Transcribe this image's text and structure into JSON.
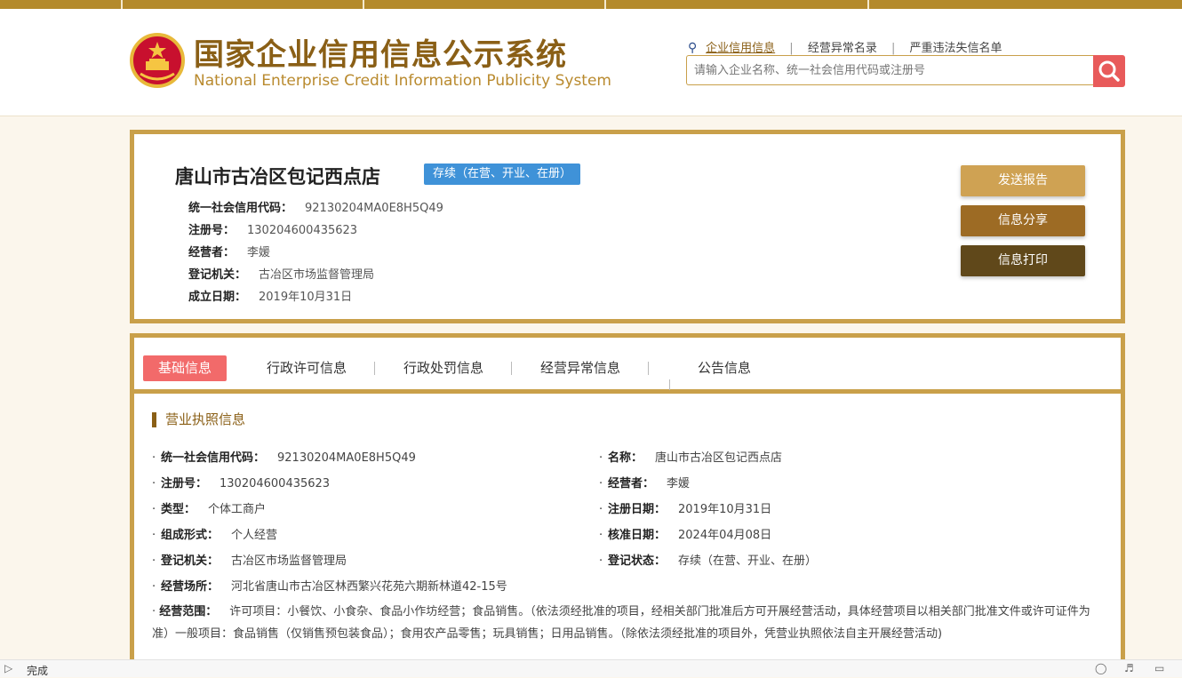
{
  "header": {
    "title_cn": "国家企业信用信息公示系统",
    "title_en": "National Enterprise Credit Information Publicity System",
    "nav": [
      "企业信用信息",
      "经营异常名录",
      "严重违法失信名单"
    ],
    "search_placeholder": "请输入企业名称、统一社会信用代码或注册号"
  },
  "summary": {
    "name": "唐山市古冶区包记西点店",
    "status": "存续（在营、开业、在册）",
    "fields": [
      {
        "label": "统一社会信用代码：",
        "value": "92130204MA0E8H5Q49"
      },
      {
        "label": "注册号：",
        "value": "130204600435623"
      },
      {
        "label": "经营者：",
        "value": "李媛"
      },
      {
        "label": "登记机关：",
        "value": "古冶区市场监督管理局"
      },
      {
        "label": "成立日期：",
        "value": "2019年10月31日"
      }
    ],
    "buttons": [
      "发送报告",
      "信息分享",
      "信息打印"
    ]
  },
  "tabs": [
    "基础信息",
    "行政许可信息",
    "行政处罚信息",
    "经营异常信息",
    "公告信息"
  ],
  "license": {
    "section_title": "营业执照信息",
    "left": [
      {
        "label": "统一社会信用代码：",
        "value": "92130204MA0E8H5Q49"
      },
      {
        "label": "注册号：",
        "value": "130204600435623"
      },
      {
        "label": "类型：",
        "value": "个体工商户"
      },
      {
        "label": "组成形式：",
        "value": "个人经营"
      },
      {
        "label": "登记机关：",
        "value": "古冶区市场监督管理局"
      },
      {
        "label": "经营场所：",
        "value": "河北省唐山市古冶区林西繁兴花苑六期新林道42-15号"
      }
    ],
    "right": [
      {
        "label": "名称：",
        "value": "唐山市古冶区包记西点店"
      },
      {
        "label": "经营者：",
        "value": "李媛"
      },
      {
        "label": "注册日期：",
        "value": "2019年10月31日"
      },
      {
        "label": "核准日期：",
        "value": "2024年04月08日"
      },
      {
        "label": "登记状态：",
        "value": "存续（在营、开业、在册）"
      }
    ],
    "scope_label": "经营范围：",
    "scope_value": "许可项目：小餐饮、小食杂、食品小作坊经营；食品销售。（依法须经批准的项目，经相关部门批准后方可开展经营活动，具体经营项目以相关部门批准文件或许可证件为准）一般项目：食品销售（仅销售预包装食品）；食用农产品零售；玩具销售；日用品销售。（除依法须经批准的项目外，凭营业执照依法自主开展经营活动)"
  },
  "statusbar": {
    "text": "完成"
  },
  "colors": {
    "gold": "#c9a04a",
    "brown": "#8a5f16",
    "badge": "#3f92d8",
    "active_tab": "#f26a6a"
  }
}
